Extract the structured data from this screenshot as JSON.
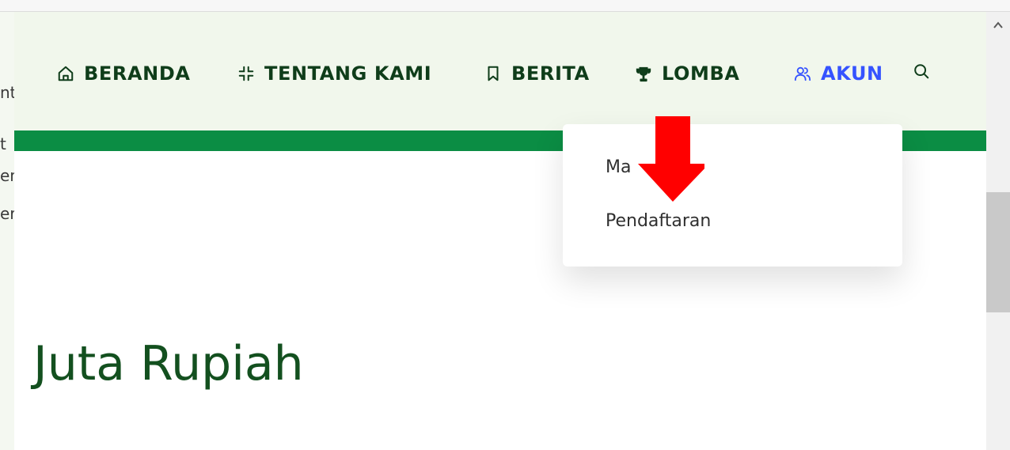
{
  "nav": {
    "items": [
      {
        "label": "BERANDA",
        "icon": "home-icon"
      },
      {
        "label": "TENTANG KAMI",
        "icon": "collapse-icon"
      },
      {
        "label": "BERITA",
        "icon": "bookmark-icon"
      },
      {
        "label": "LOMBA",
        "icon": "trophy-icon"
      },
      {
        "label": "AKUN",
        "icon": "users-icon",
        "active": true
      }
    ],
    "search_icon": "search-icon"
  },
  "dropdown": {
    "items": [
      {
        "label": "Ma"
      },
      {
        "label": "Pendaftaran"
      }
    ]
  },
  "main": {
    "headline": "Juta Rupiah"
  },
  "underlay": {
    "fragments": [
      "nt",
      "t",
      "en",
      "er"
    ]
  },
  "colors": {
    "accent_green": "#0b8d44",
    "nav_text": "#0f3d1a",
    "active_blue": "#3553ff",
    "headline_green": "#13501f",
    "arrow_red": "#ff0000"
  }
}
